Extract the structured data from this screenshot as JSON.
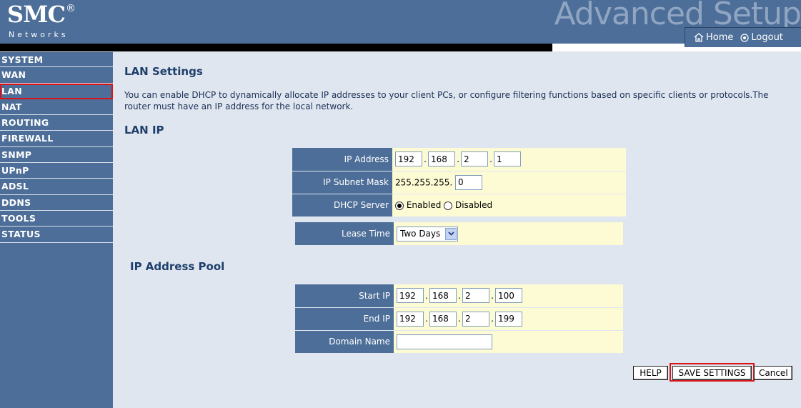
{
  "brand": {
    "logo": "SMC",
    "registered": "®",
    "sub": "Networks",
    "banner": "Advanced Setup"
  },
  "topnav": {
    "home": "Home",
    "logout": "Logout"
  },
  "sidebar": {
    "items": [
      {
        "label": "SYSTEM"
      },
      {
        "label": "WAN"
      },
      {
        "label": "LAN"
      },
      {
        "label": "NAT"
      },
      {
        "label": "ROUTING"
      },
      {
        "label": "FIREWALL"
      },
      {
        "label": "SNMP"
      },
      {
        "label": "UPnP"
      },
      {
        "label": "ADSL"
      },
      {
        "label": "DDNS"
      },
      {
        "label": "TOOLS"
      },
      {
        "label": "STATUS"
      }
    ],
    "active_index": 2
  },
  "page": {
    "title": "LAN Settings",
    "description": "You can enable DHCP to dynamically allocate IP addresses to your client PCs, or configure filtering functions based on specific clients or protocols.The router must have an IP address for the local network."
  },
  "lan_ip": {
    "heading": "LAN IP",
    "ip_label": "IP Address",
    "ip": [
      "192",
      "168",
      "2",
      "1"
    ],
    "mask_label": "IP Subnet Mask",
    "mask_prefix": "255.255.255.",
    "mask_last": "0",
    "dhcp_label": "DHCP Server",
    "dhcp_enabled": "Enabled",
    "dhcp_disabled": "Disabled",
    "lease_label": "Lease Time",
    "lease_value": "Two Days"
  },
  "pool": {
    "heading": "IP Address Pool",
    "start_label": "Start IP",
    "start": [
      "192",
      "168",
      "2",
      "100"
    ],
    "end_label": "End IP",
    "end": [
      "192",
      "168",
      "2",
      "199"
    ],
    "domain_label": "Domain Name",
    "domain_value": ""
  },
  "buttons": {
    "help": "HELP",
    "save": "SAVE SETTINGS",
    "cancel": "Cancel"
  },
  "colors": {
    "nav_blue": "#4d6e98",
    "field_yellow": "#fdfbd3",
    "highlight_red": "#d8141a",
    "heading": "#1e3e6b"
  }
}
